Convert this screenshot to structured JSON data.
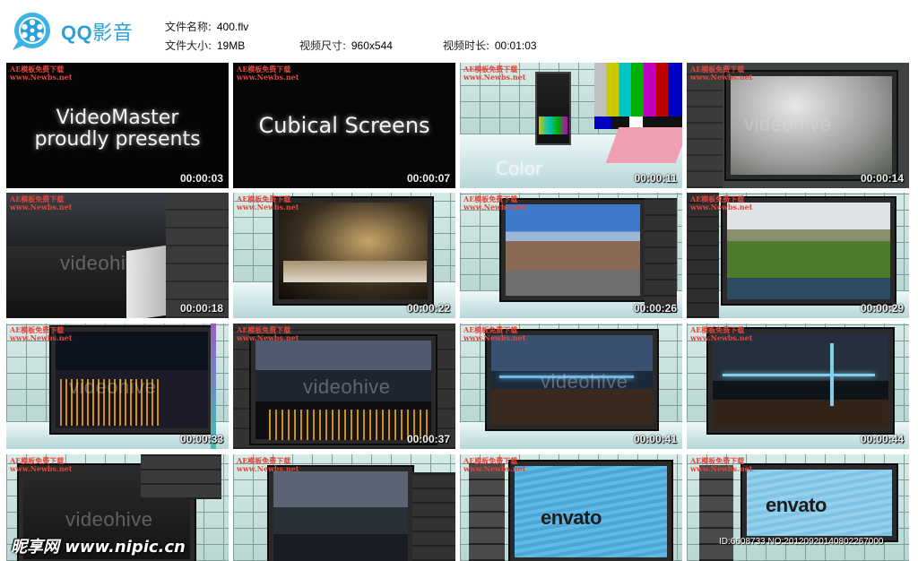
{
  "app": {
    "logo_text": "QQ",
    "logo_text_cn": "影音",
    "accent": "#2aa0d8"
  },
  "file_info": {
    "name_label": "文件名称:",
    "name_value": "400.flv",
    "size_label": "文件大小:",
    "size_value": "19MB",
    "dims_label": "视频尺寸:",
    "dims_value": "960x544",
    "duration_label": "视频时长:",
    "duration_value": "00:01:03"
  },
  "watermark_small": "AE模板免费下载\nwww.Newbs.net",
  "thumbnails": [
    {
      "time": "00:00:03",
      "caption_line1": "VideoMaster",
      "caption_line2": "proudly presents"
    },
    {
      "time": "00:00:07",
      "caption_line1": "Cubical Screens"
    },
    {
      "time": "00:00:11",
      "caption_line1": "Color"
    },
    {
      "time": "00:00:14",
      "brand": "videohive"
    },
    {
      "time": "00:00:18",
      "brand": "videohive"
    },
    {
      "time": "00:00:22"
    },
    {
      "time": "00:00:26"
    },
    {
      "time": "00:00:29"
    },
    {
      "time": "00:00:33",
      "brand": "videohive"
    },
    {
      "time": "00:00:37",
      "brand": "videohive"
    },
    {
      "time": "00:00:41",
      "brand": "videohive"
    },
    {
      "time": "00:00:44"
    },
    {
      "time": "",
      "brand": "videohive"
    },
    {
      "time": ""
    },
    {
      "time": "",
      "brand": "envato"
    },
    {
      "time": "",
      "brand": "envato"
    }
  ],
  "footer": {
    "site": "昵享网 www.nipic.cn",
    "id": "ID:6608733 NO:20120920140802267000"
  }
}
